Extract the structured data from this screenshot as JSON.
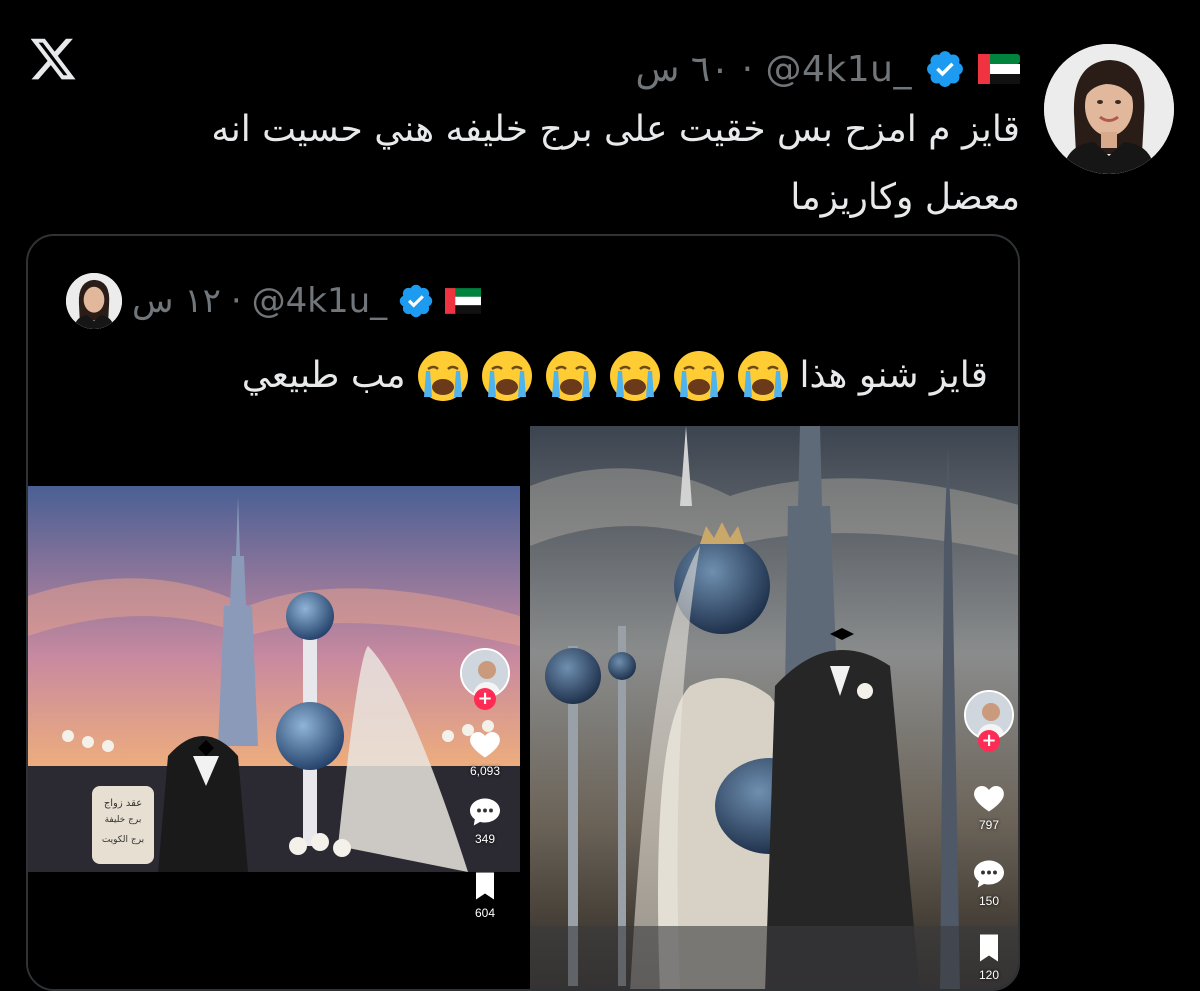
{
  "main_tweet": {
    "handle": "@4k1u_",
    "time": "٦٠ س",
    "separator": "·",
    "text_line1": "قايز م امزح بس خقيت على برج خليفه هني حسيت انه",
    "text_line2": "معضل وكاريزما"
  },
  "quoted_tweet": {
    "handle": "@4k1u_",
    "time": "١٢ س",
    "separator": "·",
    "text": "قايز شنو هذا",
    "text_tail": "مب طبيعي",
    "emoji_count": 6
  },
  "left_video": {
    "likes": "6,093",
    "comments": "349",
    "saves": "604",
    "certificate": "عقد زواج برج خليفة و برج الكويت"
  },
  "right_video": {
    "likes": "797",
    "comments": "150",
    "saves": "120"
  },
  "icons": [
    "x-logo-icon",
    "uae-flag-icon",
    "verified-badge-icon",
    "crying-face-emoji",
    "heart-icon",
    "comment-icon",
    "bookmark-icon",
    "follow-plus-icon"
  ],
  "colors": {
    "background": "#000000",
    "text": "#e7e9ea",
    "muted": "#71767b",
    "verified": "#1d9bf0",
    "card_border": "#2f3336",
    "tiktok_red": "#fe2c55"
  }
}
